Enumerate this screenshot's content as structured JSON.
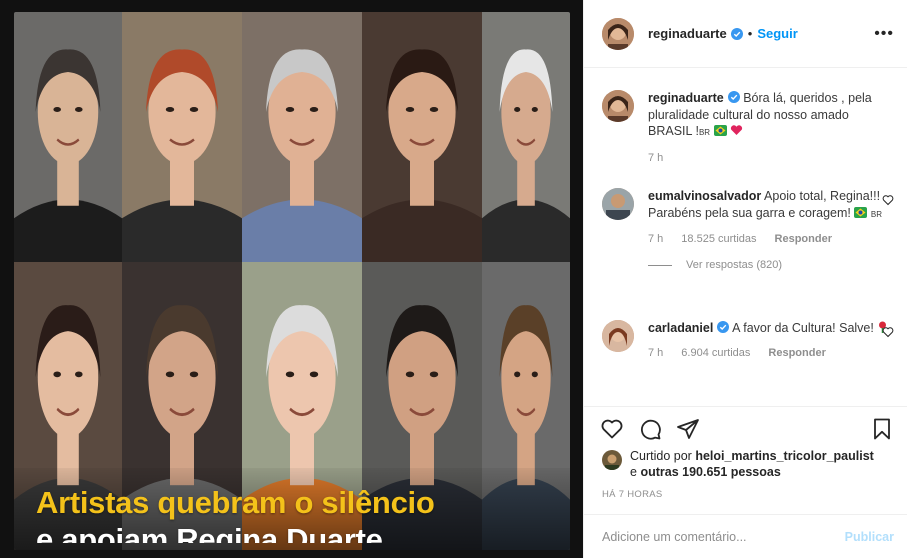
{
  "post_image": {
    "headline_line1": "Artistas quebram o silêncio",
    "headline_line2": "e apoiam Regina Duarte"
  },
  "header": {
    "username": "reginaduarte",
    "separator": "•",
    "follow_label": "Seguir",
    "more_label": "•••"
  },
  "comments": [
    {
      "user": "reginaduarte",
      "text": " Bóra lá, queridos , pela pluralidade cultural do nosso amado BRASIL !",
      "flag_text": "BR",
      "time": "7 h"
    },
    {
      "user": "eumalvinosalvador",
      "text": " Apoio total, Regina!!! Parabéns pela sua garra e coragem!",
      "flag_text": "BR",
      "time": "7 h",
      "likes": "18.525 curtidas",
      "reply_label": "Responder",
      "view_replies": "Ver respostas (820)"
    },
    {
      "user": "carladaniel",
      "text": " A favor da Cultura! Salve!",
      "time": "7 h",
      "likes": "6.904 curtidas",
      "reply_label": "Responder"
    }
  ],
  "likes_summary": {
    "prefix": "Curtido por ",
    "user": "heloi_martins_tricolor_paulist",
    "suffix_prefix": "e ",
    "others": "outras 190.651 pessoas"
  },
  "time_ago": "HÁ 7 HORAS",
  "add_comment": {
    "placeholder": "Adicione um comentário...",
    "publish_label": "Publicar"
  },
  "colors": {
    "accent": "#0095f6",
    "headline_yellow": "#f4c21a",
    "muted": "#8e8e8e"
  }
}
